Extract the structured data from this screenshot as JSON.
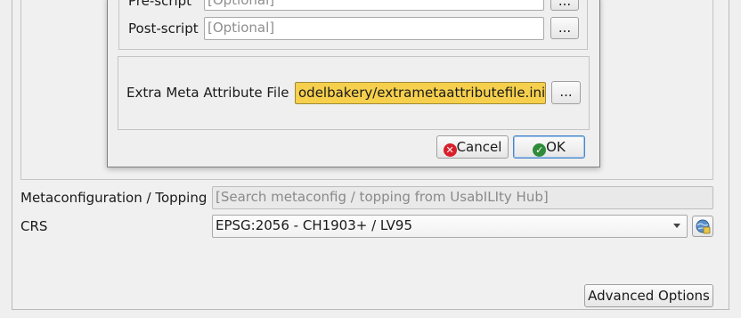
{
  "dialog": {
    "prescript_label": "Pre-script",
    "prescript_placeholder": "[Optional]",
    "postscript_label": "Post-script",
    "postscript_placeholder": "[Optional]",
    "browse_label": "...",
    "extra_meta_label": "Extra Meta Attribute File",
    "extra_meta_value": "odelbakery/extrametaattributefile.ini",
    "cancel_label": "Cancel",
    "ok_label": "OK"
  },
  "main": {
    "metaconfig_label": "Metaconfiguration / Topping",
    "metaconfig_placeholder": "[Search metaconfig / topping from UsabILIty Hub]",
    "crs_label": "CRS",
    "crs_value": "EPSG:2056 - CH1903+ / LV95",
    "advanced_options_label": "Advanced Options"
  },
  "icons": {
    "cancel": "cancel-icon",
    "ok": "ok-icon",
    "crs_selector": "crs-globe-icon",
    "combo": "chevron-down-icon"
  },
  "colors": {
    "highlight": "#f6d04d",
    "cancel_icon": "#d8202a",
    "ok_icon": "#2e8b3a",
    "default_button_border": "#4a86c8"
  }
}
